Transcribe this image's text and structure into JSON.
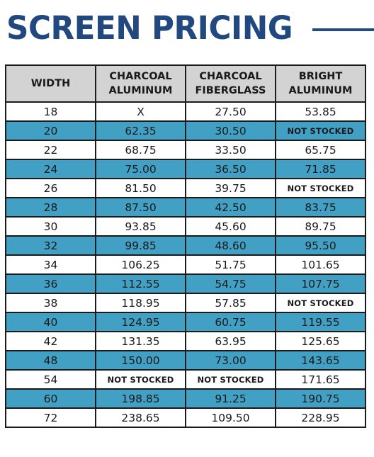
{
  "title": "SCREEN PRICING",
  "colors": {
    "title": "#21497f",
    "header_bg": "#d3d3d3",
    "alt_row_bg": "#42a0c4",
    "border": "#1b1b1b"
  },
  "table": {
    "headers": [
      {
        "line1": "WIDTH",
        "line2": ""
      },
      {
        "line1": "CHARCOAL",
        "line2": "ALUMINUM"
      },
      {
        "line1": "CHARCOAL",
        "line2": "FIBERGLASS"
      },
      {
        "line1": "BRIGHT",
        "line2": "ALUMINUM"
      }
    ],
    "rows": [
      [
        "18",
        "X",
        "27.50",
        "53.85"
      ],
      [
        "20",
        "62.35",
        "30.50",
        "NOT STOCKED"
      ],
      [
        "22",
        "68.75",
        "33.50",
        "65.75"
      ],
      [
        "24",
        "75.00",
        "36.50",
        "71.85"
      ],
      [
        "26",
        "81.50",
        "39.75",
        "NOT STOCKED"
      ],
      [
        "28",
        "87.50",
        "42.50",
        "83.75"
      ],
      [
        "30",
        "93.85",
        "45.60",
        "89.75"
      ],
      [
        "32",
        "99.85",
        "48.60",
        "95.50"
      ],
      [
        "34",
        "106.25",
        "51.75",
        "101.65"
      ],
      [
        "36",
        "112.55",
        "54.75",
        "107.75"
      ],
      [
        "38",
        "118.95",
        "57.85",
        "NOT STOCKED"
      ],
      [
        "40",
        "124.95",
        "60.75",
        "119.55"
      ],
      [
        "42",
        "131.35",
        "63.95",
        "125.65"
      ],
      [
        "48",
        "150.00",
        "73.00",
        "143.65"
      ],
      [
        "54",
        "NOT STOCKED",
        "NOT STOCKED",
        "171.65"
      ],
      [
        "60",
        "198.85",
        "91.25",
        "190.75"
      ],
      [
        "72",
        "238.65",
        "109.50",
        "228.95"
      ]
    ]
  }
}
